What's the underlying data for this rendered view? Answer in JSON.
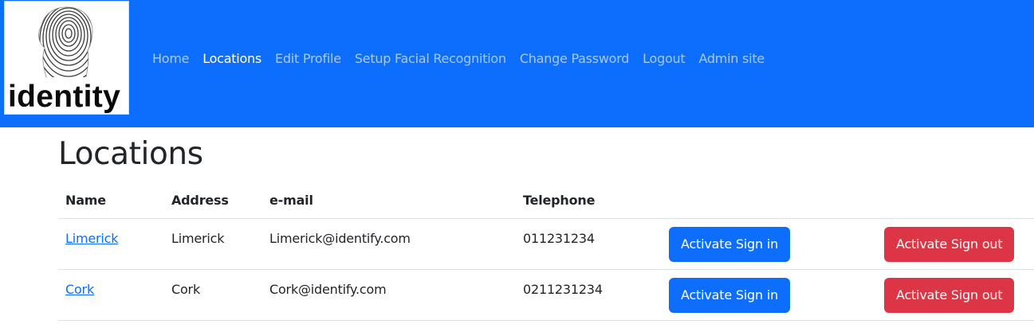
{
  "brand": {
    "logo_text": "identity",
    "logo_icon": "fingerprint-head-icon"
  },
  "nav": {
    "items": [
      {
        "label": "Home",
        "active": false
      },
      {
        "label": "Locations",
        "active": true
      },
      {
        "label": "Edit Profile",
        "active": false
      },
      {
        "label": "Setup Facial Recognition",
        "active": false
      },
      {
        "label": "Change Password",
        "active": false
      },
      {
        "label": "Logout",
        "active": false
      },
      {
        "label": "Admin site",
        "active": false
      }
    ]
  },
  "page": {
    "title": "Locations"
  },
  "table": {
    "headers": [
      "Name",
      "Address",
      "e-mail",
      "Telephone"
    ],
    "rows": [
      {
        "name": "Limerick",
        "address": "Limerick",
        "email": "Limerick@identify.com",
        "telephone": "011231234",
        "sign_in_label": "Activate Sign in",
        "sign_out_label": "Activate Sign out"
      },
      {
        "name": "Cork",
        "address": "Cork",
        "email": "Cork@identify.com",
        "telephone": "0211231234",
        "sign_in_label": "Activate Sign in",
        "sign_out_label": "Activate Sign out"
      }
    ]
  },
  "colors": {
    "navbar": "#0d6efd",
    "primary": "#0d6efd",
    "danger": "#dc3545",
    "text": "#212529",
    "link": "#0d6efd"
  }
}
